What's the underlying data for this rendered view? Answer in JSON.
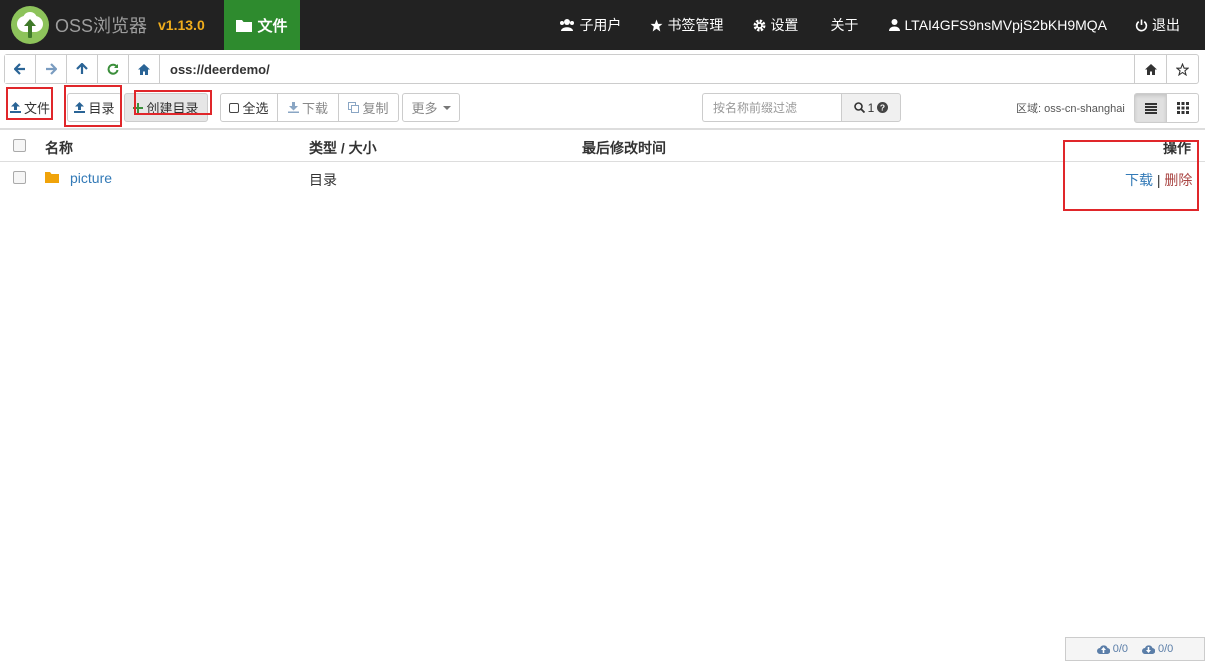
{
  "brand": {
    "name": "OSS浏览器",
    "version": "v1.13.0"
  },
  "nav": {
    "active_tab": "文件",
    "items": [
      {
        "key": "subusers",
        "label": "子用户"
      },
      {
        "key": "bookmarks",
        "label": "书签管理"
      },
      {
        "key": "settings",
        "label": "设置"
      },
      {
        "key": "about",
        "label": "关于"
      },
      {
        "key": "account",
        "label": "LTAI4GFS9nsMVpjS2bKH9MQA"
      },
      {
        "key": "logout",
        "label": "退出"
      }
    ]
  },
  "address": {
    "path": "oss://deerdemo/"
  },
  "toolbar": {
    "upload_file": "文件",
    "upload_dir": "目录",
    "create_dir": "创建目录",
    "select_all": "全选",
    "download": "下载",
    "copy": "复制",
    "more": "更多",
    "filter_placeholder": "按名称前缀过滤",
    "filter_count": "1",
    "region": "区域: oss-cn-shanghai"
  },
  "table": {
    "columns": [
      "名称",
      "类型 / 大小",
      "最后修改时间",
      "操作"
    ],
    "rows": [
      {
        "name": "picture",
        "type": "目录",
        "modified": "",
        "actions": [
          "下载",
          "删除"
        ]
      }
    ]
  },
  "status": {
    "upload": "0/0",
    "download": "0/0"
  },
  "colors": {
    "navbar": "#222222",
    "active_tab": "#2e8b2e",
    "version": "#f0ad1c",
    "highlight_box": "#e0262a",
    "folder": "#f0a30a"
  }
}
